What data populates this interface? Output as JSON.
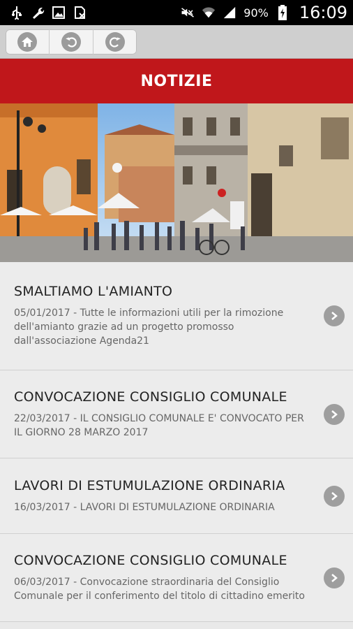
{
  "status_bar": {
    "left_icons": [
      "usb-icon",
      "wrench-icon",
      "image-icon",
      "no-sim-icon"
    ],
    "right_icons": [
      "mute-icon",
      "wifi-icon",
      "signal-icon",
      "battery-charging-icon"
    ],
    "battery": "90%",
    "time": "16:09"
  },
  "toolbar": {
    "buttons": [
      {
        "icon": "home-icon"
      },
      {
        "icon": "back-icon"
      },
      {
        "icon": "refresh-icon"
      }
    ]
  },
  "header": {
    "title": "NOTIZIE"
  },
  "colors": {
    "accent": "#c0171b",
    "list_bg": "#ececec",
    "chevron": "#9e9e9e"
  },
  "news": [
    {
      "title": "SMALTIAMO L'AMIANTO",
      "desc": "05/01/2017 - Tutte le informazioni utili per la rimozione dell'amianto grazie ad un progetto promosso dall'associazione Agenda21"
    },
    {
      "title": "CONVOCAZIONE CONSIGLIO COMUNALE",
      "desc": "22/03/2017 - IL CONSIGLIO COMUNALE E' CONVOCATO PER IL GIORNO 28 MARZO 2017"
    },
    {
      "title": "LAVORI DI ESTUMULAZIONE ORDINARIA",
      "desc": "16/03/2017 - LAVORI DI ESTUMULAZIONE ORDINARIA"
    },
    {
      "title": "CONVOCAZIONE CONSIGLIO COMUNALE",
      "desc": "06/03/2017 - Convocazione straordinaria del Consiglio Comunale per il conferimento del titolo di cittadino emerito"
    }
  ]
}
